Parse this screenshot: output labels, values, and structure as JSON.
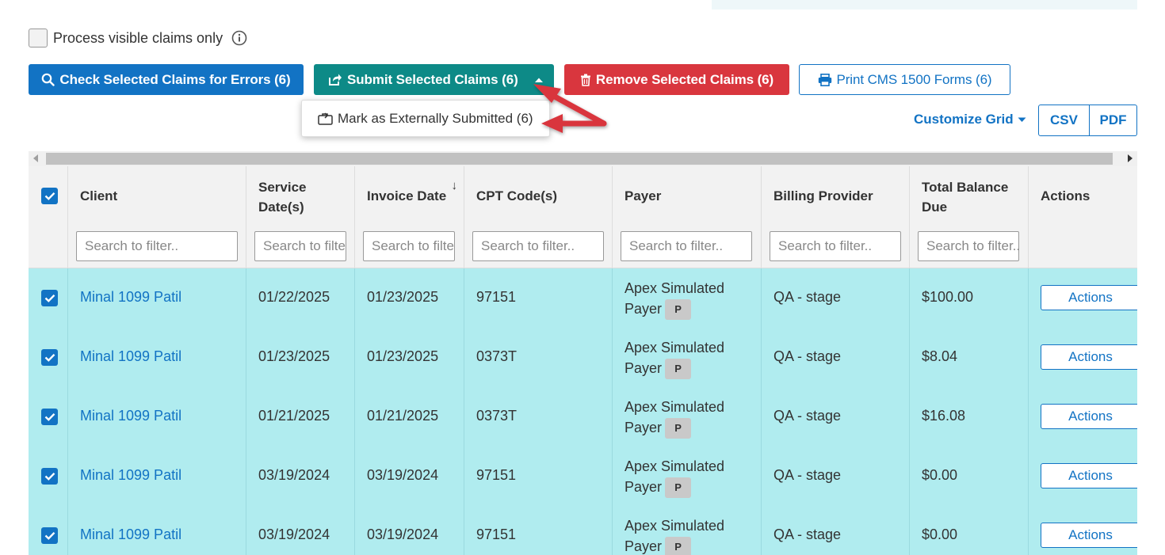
{
  "process_toggle": {
    "label": "Process visible claims only",
    "checked": false
  },
  "toolbar": {
    "check_label": "Check Selected Claims for Errors (6)",
    "submit_label": "Submit Selected Claims (6)",
    "remove_label": "Remove Selected Claims (6)",
    "print_label": "Print CMS 1500 Forms (6)"
  },
  "submit_menu": {
    "items": [
      {
        "label": "Mark as Externally Submitted (6)"
      }
    ]
  },
  "grid_controls": {
    "customize_label": "Customize Grid",
    "csv_label": "CSV",
    "pdf_label": "PDF"
  },
  "grid": {
    "columns": [
      {
        "title": "Client",
        "placeholder": "Search to filter.."
      },
      {
        "title": "Service Date(s)",
        "placeholder": "Search to filter.."
      },
      {
        "title": "Invoice Date",
        "placeholder": "Search to filter..",
        "sorted": "desc"
      },
      {
        "title": "CPT Code(s)",
        "placeholder": "Search to filter.."
      },
      {
        "title": "Payer",
        "placeholder": "Search to filter.."
      },
      {
        "title": "Billing Provider",
        "placeholder": "Search to filter.."
      },
      {
        "title": "Total Balance Due",
        "placeholder": "Search to filter.."
      },
      {
        "title": "Actions"
      }
    ],
    "header_checked": true,
    "rows": [
      {
        "checked": true,
        "client": "Minal 1099 Patil",
        "service_date": "01/22/2025",
        "invoice_date": "01/23/2025",
        "cpt": "97151",
        "payer": "Apex Simulated Payer",
        "payer_badge": "P",
        "billing_provider": "QA - stage",
        "balance": "$100.00",
        "action_label": "Actions"
      },
      {
        "checked": true,
        "client": "Minal 1099 Patil",
        "service_date": "01/23/2025",
        "invoice_date": "01/23/2025",
        "cpt": "0373T",
        "payer": "Apex Simulated Payer",
        "payer_badge": "P",
        "billing_provider": "QA - stage",
        "balance": "$8.04",
        "action_label": "Actions"
      },
      {
        "checked": true,
        "client": "Minal 1099 Patil",
        "service_date": "01/21/2025",
        "invoice_date": "01/21/2025",
        "cpt": "0373T",
        "payer": "Apex Simulated Payer",
        "payer_badge": "P",
        "billing_provider": "QA - stage",
        "balance": "$16.08",
        "action_label": "Actions"
      },
      {
        "checked": true,
        "client": "Minal 1099 Patil",
        "service_date": "03/19/2024",
        "invoice_date": "03/19/2024",
        "cpt": "97151",
        "payer": "Apex Simulated Payer",
        "payer_badge": "P",
        "billing_provider": "QA - stage",
        "balance": "$0.00",
        "action_label": "Actions"
      },
      {
        "checked": true,
        "client": "Minal 1099 Patil",
        "service_date": "03/19/2024",
        "invoice_date": "03/19/2024",
        "cpt": "97151",
        "payer": "Apex Simulated Payer",
        "payer_badge": "P",
        "billing_provider": "QA - stage",
        "balance": "$0.00",
        "action_label": "Actions"
      }
    ]
  },
  "colors": {
    "primary": "#1273c4",
    "teal": "#0d8a87",
    "danger": "#d9363e",
    "row_selected": "#b0ecef",
    "annotation": "#d9363e"
  }
}
